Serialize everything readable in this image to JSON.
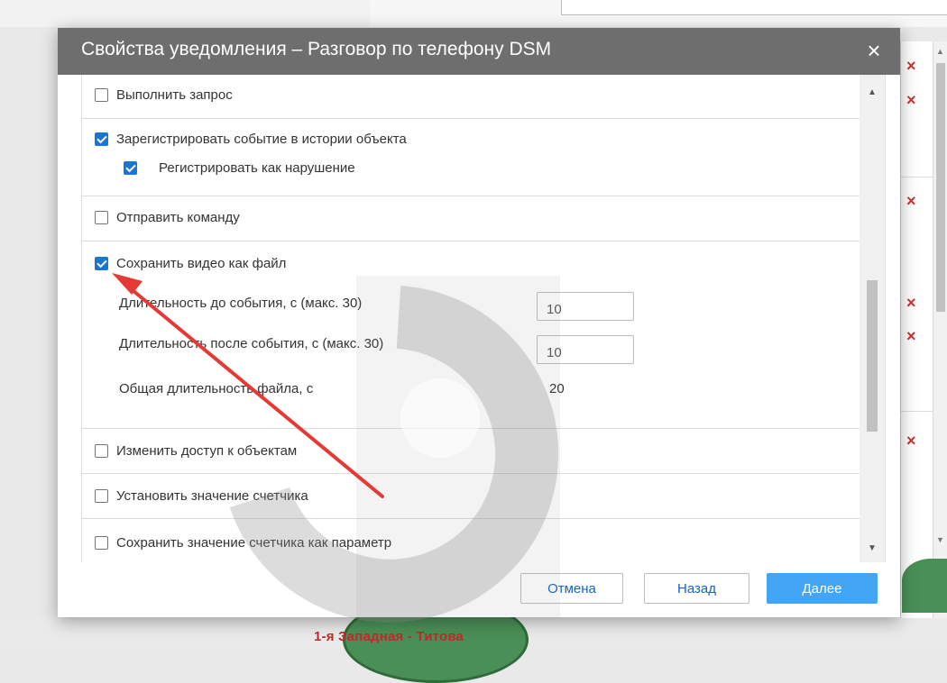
{
  "background": {
    "map_label": "1-я Западная - Титова",
    "close_marks": [
      "×",
      "×",
      "×",
      "×",
      "×",
      "×"
    ],
    "scroll_up": "▲",
    "scroll_down": "▼"
  },
  "dialog": {
    "title": "Свойства уведомления – Разговор по телефону DSM",
    "close": "×",
    "sections": {
      "execute_request": {
        "label": "Выполнить запрос",
        "checked": false
      },
      "register_event": {
        "label": "Зарегистрировать событие в истории объекта",
        "checked": true
      },
      "register_violation": {
        "label": "Регистрировать как нарушение",
        "checked": true
      },
      "send_command": {
        "label": "Отправить команду",
        "checked": false
      },
      "save_video": {
        "label": "Сохранить видео как файл",
        "checked": true
      },
      "change_access": {
        "label": "Изменить доступ к объектам",
        "checked": false
      },
      "set_counter": {
        "label": "Установить значение счетчика",
        "checked": false
      },
      "save_counter": {
        "label": "Сохранить значение счетчика как параметр",
        "checked": false
      }
    },
    "video": {
      "before_label": "Длительность до события, с (макс. 30)",
      "before_value": "10",
      "after_label": "Длительность после события, с (макс. 30)",
      "after_value": "10",
      "total_label": "Общая длительность файла, с",
      "total_value": "20"
    },
    "scroll_up": "▲",
    "scroll_down": "▼",
    "buttons": {
      "cancel": "Отмена",
      "back": "Назад",
      "next": "Далее"
    }
  },
  "colors": {
    "header": "#6e6e6e",
    "checkbox_checked": "#1976d2",
    "primary_button": "#42a5f5",
    "link_text": "#1565c0",
    "annotation_arrow": "#e53935",
    "close_mark": "#d32f2f"
  }
}
